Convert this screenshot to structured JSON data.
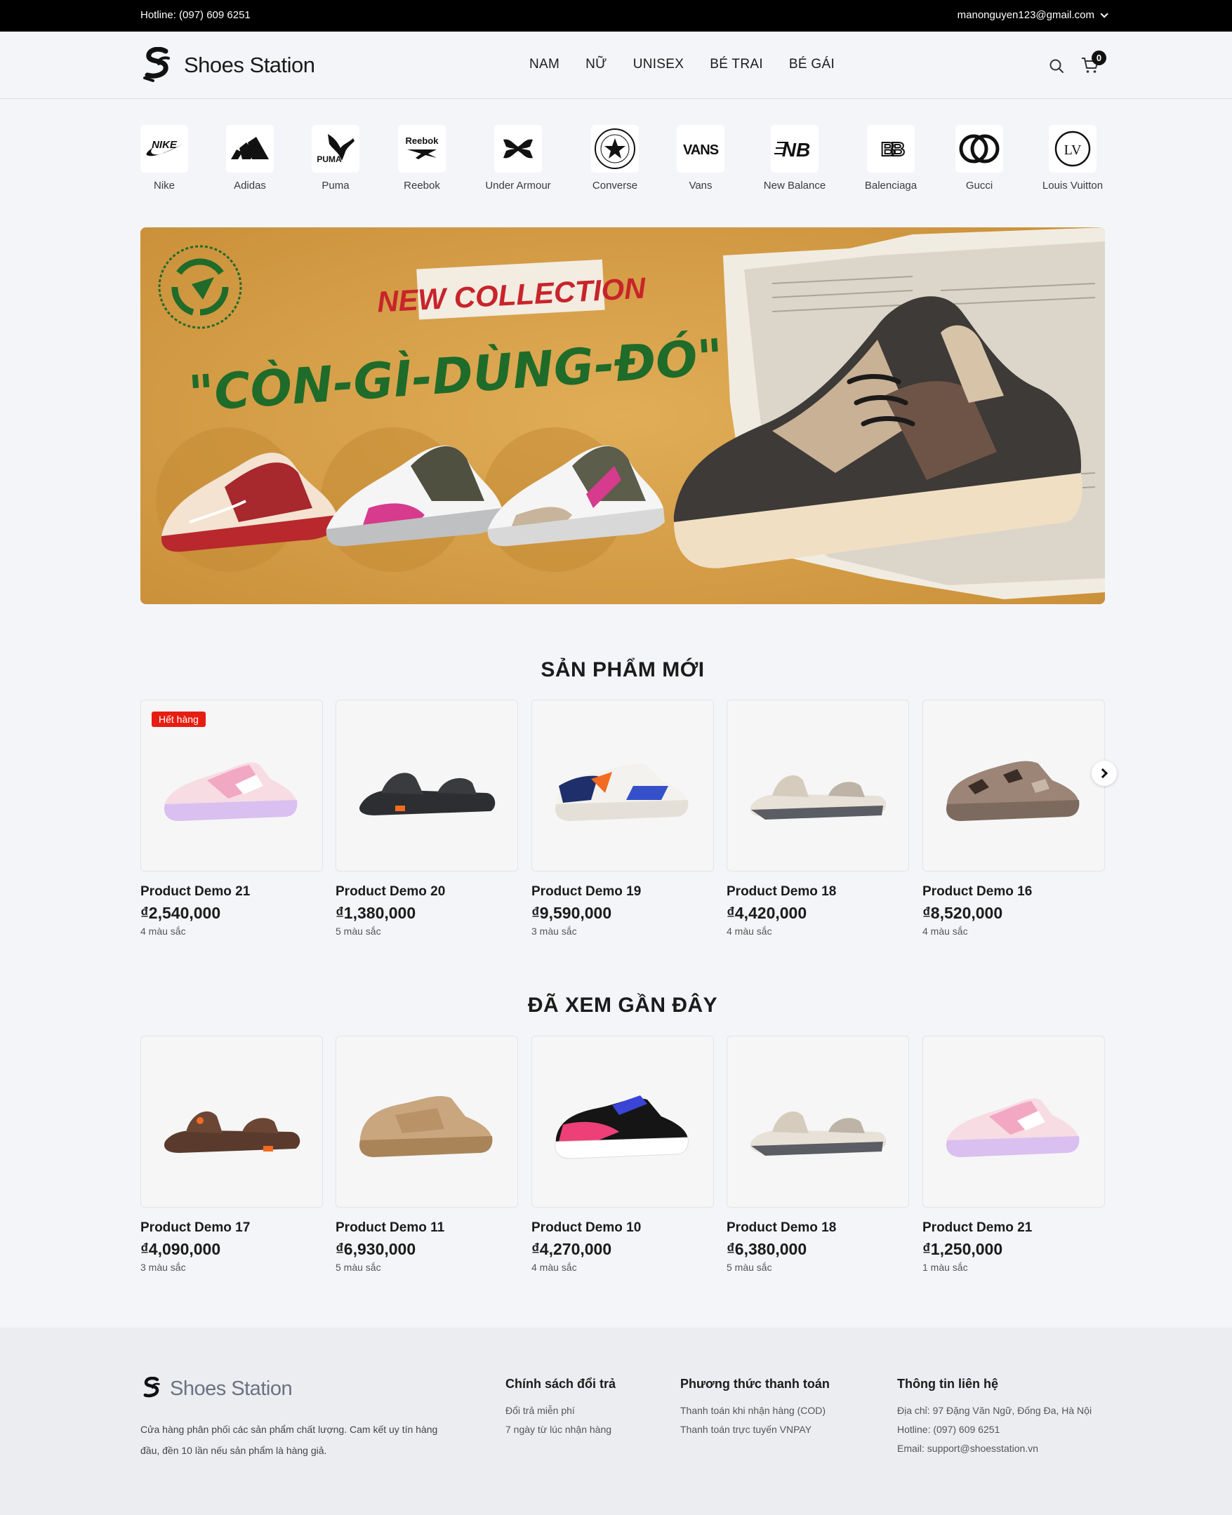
{
  "topbar": {
    "hotline": "Hotline: (097) 609 6251",
    "account_email": "manonguyen123@gmail.com",
    "account_icon": "chevron-down-icon"
  },
  "header": {
    "brand": "Shoes Station",
    "nav": [
      "NAM",
      "NỮ",
      "UNISEX",
      "BÉ TRAI",
      "BÉ GÁI"
    ],
    "cart_count": "0",
    "icons": [
      "search-icon",
      "cart-icon"
    ]
  },
  "brands": [
    {
      "name": "Nike",
      "logo_text": "NIKE"
    },
    {
      "name": "Adidas",
      "logo_text": ""
    },
    {
      "name": "Puma",
      "logo_text": "PUMA"
    },
    {
      "name": "Reebok",
      "logo_text": "Reebok"
    },
    {
      "name": "Under Armour",
      "logo_text": ""
    },
    {
      "name": "Converse",
      "logo_text": "CONVERSE ALL STAR"
    },
    {
      "name": "Vans",
      "logo_text": "VANS"
    },
    {
      "name": "New Balance",
      "logo_text": "NB"
    },
    {
      "name": "Balenciaga",
      "logo_text": "BB"
    },
    {
      "name": "Gucci",
      "logo_text": "GG"
    },
    {
      "name": "Louis Vuitton",
      "logo_text": "LV"
    }
  ],
  "banner": {
    "tag": "NEW COLLECTION",
    "headline": "\"CÒN-GÌ-DÙNG-ĐÓ\"",
    "colors": {
      "background": "#d9a24a",
      "headline": "#1f6b2a",
      "tag_bg": "#f2ece1",
      "tag_text": "#c8242b"
    }
  },
  "new_products": {
    "title": "SẢN PHẨM MỚI",
    "items": [
      {
        "name": "Product Demo 21",
        "price": "₫2,540,000",
        "colors": "4 màu sắc",
        "badge": "Hết hàng",
        "shoe": "pink-runner"
      },
      {
        "name": "Product Demo 20",
        "price": "₫1,380,000",
        "colors": "5 màu sắc",
        "badge": "",
        "shoe": "black-sandal"
      },
      {
        "name": "Product Demo 19",
        "price": "₫9,590,000",
        "colors": "3 màu sắc",
        "badge": "",
        "shoe": "white-sneaker"
      },
      {
        "name": "Product Demo 18",
        "price": "₫4,420,000",
        "colors": "4 màu sắc",
        "badge": "",
        "shoe": "grey-sandal"
      },
      {
        "name": "Product Demo 16",
        "price": "₫8,520,000",
        "colors": "4 màu sắc",
        "badge": "",
        "shoe": "camo-sneaker"
      }
    ],
    "next_icon": "chevron-right-icon"
  },
  "recent_products": {
    "title": "ĐÃ XEM GẦN ĐÂY",
    "items": [
      {
        "name": "Product Demo 17",
        "price": "₫4,090,000",
        "colors": "3 màu sắc",
        "shoe": "brown-sandal"
      },
      {
        "name": "Product Demo 11",
        "price": "₫6,930,000",
        "colors": "5 màu sắc",
        "shoe": "tan-sneaker"
      },
      {
        "name": "Product Demo 10",
        "price": "₫4,270,000",
        "colors": "4 màu sắc",
        "shoe": "black-runner"
      },
      {
        "name": "Product Demo 18",
        "price": "₫6,380,000",
        "colors": "5 màu sắc",
        "shoe": "grey-sandal"
      },
      {
        "name": "Product Demo 21",
        "price": "₫1,250,000",
        "colors": "1 màu sắc",
        "shoe": "pink-runner"
      }
    ]
  },
  "footer": {
    "brand": "Shoes Station",
    "description": "Cửa hàng phân phối các sản phẩm chất lượng. Cam kết uy tín hàng đầu, đền 10 lần nếu sản phẩm là hàng giả.",
    "columns": [
      {
        "title": "Chính sách đổi trả",
        "lines": [
          "Đổi trả miễn phí",
          "7 ngày từ lúc nhận hàng"
        ]
      },
      {
        "title": "Phương thức thanh toán",
        "lines": [
          "Thanh toán khi nhận hàng (COD)",
          "Thanh toán trực tuyến VNPAY"
        ]
      },
      {
        "title": "Thông tin liên hệ",
        "lines": [
          "Địa chỉ: 97 Đặng Văn Ngữ, Đống Đa, Hà Nội",
          "Hotline: (097) 609 6251",
          "Email: support@shoesstation.vn"
        ]
      }
    ]
  }
}
